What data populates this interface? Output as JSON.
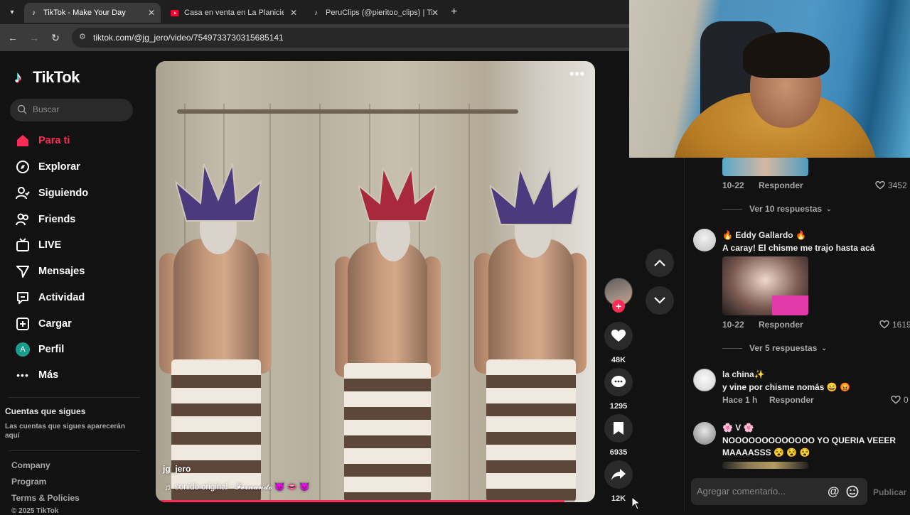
{
  "browser": {
    "tabs": [
      {
        "title": "TikTok - Make Your Day",
        "icon": "tiktok-icon",
        "active": true
      },
      {
        "title": "Casa en venta en La Planicie, La",
        "icon": "youtube-icon",
        "active": false
      },
      {
        "title": "PeruClips (@pieritoo_clips) | Tik",
        "icon": "tiktok-icon",
        "active": false
      }
    ],
    "url": "tiktok.com/@jg_jero/video/7549733730315685141"
  },
  "sidebar": {
    "logo": "TikTok",
    "search_placeholder": "Buscar",
    "nav": [
      {
        "label": "Para ti",
        "icon": "home-icon",
        "active": true
      },
      {
        "label": "Explorar",
        "icon": "compass-icon"
      },
      {
        "label": "Siguiendo",
        "icon": "following-icon"
      },
      {
        "label": "Friends",
        "icon": "friends-icon"
      },
      {
        "label": "LIVE",
        "icon": "live-icon"
      },
      {
        "label": "Mensajes",
        "icon": "messages-icon"
      },
      {
        "label": "Actividad",
        "icon": "activity-icon"
      },
      {
        "label": "Cargar",
        "icon": "upload-icon"
      },
      {
        "label": "Perfil",
        "icon": "profile-avatar",
        "avatar_letter": "A"
      },
      {
        "label": "Más",
        "icon": "more-icon"
      }
    ],
    "following_title": "Cuentas que sigues",
    "following_desc": "Las cuentas que sigues aparecerán aquí",
    "footer": [
      "Company",
      "Program",
      "Terms & Policies",
      "© 2025 TikTok"
    ]
  },
  "video": {
    "author": "jg_jero",
    "sound": "sonido original - 𝓕𝓮𝓻𝓷𝓪𝓷𝓭𝓸 😈 👄 👿",
    "progress": 0.93
  },
  "actions": {
    "likes": "48K",
    "comments": "1295",
    "saves": "6935",
    "shares": "12K"
  },
  "comments": {
    "items": [
      {
        "date": "10-22",
        "reply": "Responder",
        "likes": "3452",
        "view_replies": "Ver 10 respuestas"
      },
      {
        "name": "🔥 Eddy Gallardo 🔥",
        "text": "A caray! El chisme me trajo hasta acá",
        "date": "10-22",
        "reply": "Responder",
        "likes": "1619",
        "view_replies": "Ver 5 respuestas"
      },
      {
        "name": "la china✨",
        "text": "y vine por chisme nomás 😄 😡",
        "date": "Hace 1 h",
        "reply": "Responder",
        "likes": "0"
      },
      {
        "name": "🌸 V 🌸",
        "text": "NOOOOOOOOOOOOO YO QUERIA VEEER",
        "text2": "MAAAASSS 😵 😵 😵"
      }
    ],
    "input_placeholder": "Agregar comentario...",
    "publish": "Publicar"
  },
  "colors": {
    "accent": "#fe2c55",
    "bg": "#121212"
  }
}
